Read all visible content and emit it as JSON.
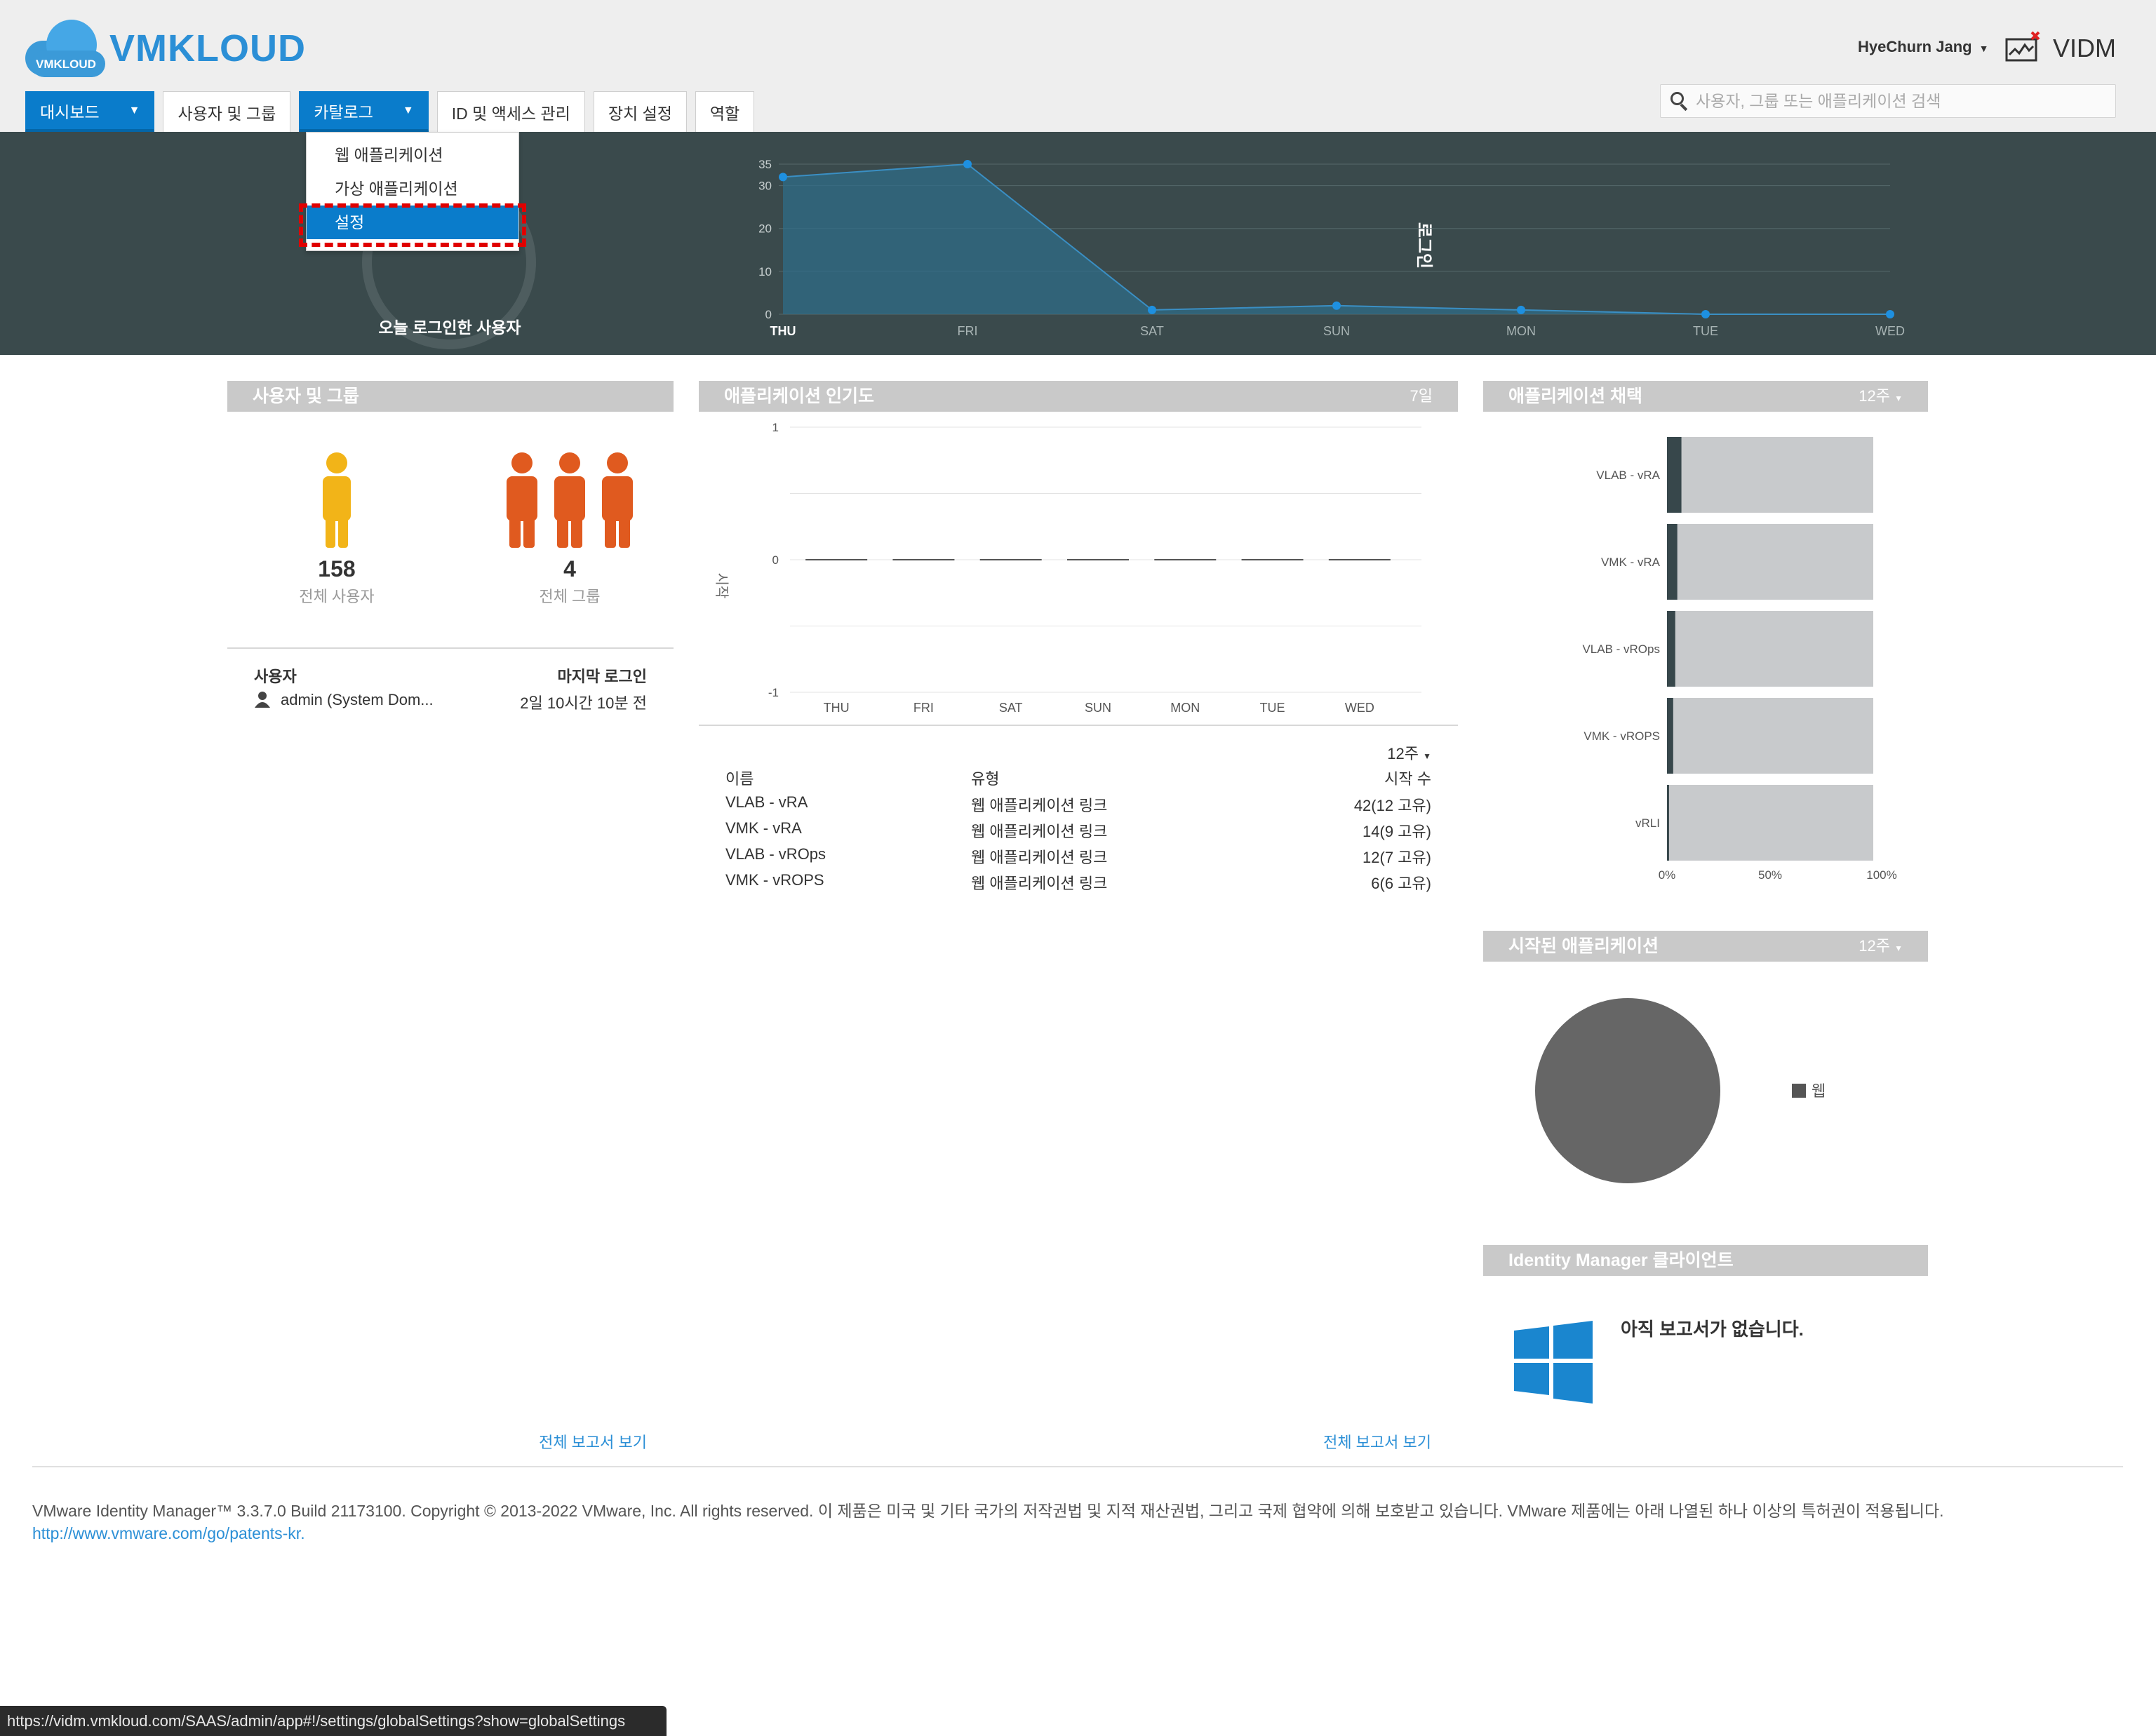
{
  "brand": {
    "logo_badge": "VMKLOUD",
    "name": "VMKLOUD"
  },
  "header": {
    "user_name": "HyeChurn Jang",
    "tenant": "VIDM"
  },
  "nav": {
    "tabs": [
      {
        "label": "대시보드",
        "active": true,
        "has_menu": true
      },
      {
        "label": "사용자 및 그룹"
      },
      {
        "label": "카탈로그",
        "active": true,
        "has_menu": true
      },
      {
        "label": "ID 및 액세스 관리"
      },
      {
        "label": "장치 설정"
      },
      {
        "label": "역할"
      }
    ],
    "catalog_menu": [
      "웹 애플리케이션",
      "가상 애플리케이션",
      "설정"
    ],
    "catalog_menu_highlighted": "설정"
  },
  "search": {
    "placeholder": "사용자, 그룹 또는 애플리케이션 검색"
  },
  "banner": {
    "gauge_label": "오늘 로그인한 사용자",
    "chart_data": {
      "type": "area",
      "ylabel": "로그인",
      "ylim": [
        0,
        35
      ],
      "yticks": [
        0,
        10,
        20,
        30,
        35
      ],
      "categories": [
        "THU",
        "FRI",
        "SAT",
        "SUN",
        "MON",
        "TUE",
        "WED"
      ],
      "values": [
        32,
        35,
        1,
        2,
        1,
        0,
        0
      ],
      "highlighted_category": "THU"
    }
  },
  "users_panel": {
    "title": "사용자 및 그룹",
    "total_users": "158",
    "total_users_label": "전체 사용자",
    "total_groups": "4",
    "total_groups_label": "전체 그룹",
    "col_user": "사용자",
    "col_last_login": "마지막 로그인",
    "rows": [
      {
        "user": "admin (System Dom...",
        "last_login": "2일 10시간 10분 전"
      }
    ],
    "view_all": "전체 보고서 보기",
    "colors": {
      "user": "#f2b418",
      "group": "#e05a1f"
    }
  },
  "popularity_panel": {
    "title": "애플리케이션 인기도",
    "range": "7일",
    "chart_data": {
      "type": "bar",
      "ylabel": "시작",
      "ylim": [
        -1,
        1
      ],
      "yticks": [
        1,
        0,
        -1
      ],
      "categories": [
        "THU",
        "FRI",
        "SAT",
        "SUN",
        "MON",
        "TUE",
        "WED"
      ],
      "values": [
        0,
        0,
        0,
        0,
        0,
        0,
        0
      ]
    },
    "period": "12주",
    "table": {
      "headers": [
        "이름",
        "유형",
        "시작 수"
      ],
      "rows": [
        [
          "VLAB - vRA",
          "웹 애플리케이션 링크",
          "42(12 고유)"
        ],
        [
          "VMK - vRA",
          "웹 애플리케이션 링크",
          "14(9 고유)"
        ],
        [
          "VLAB - vROps",
          "웹 애플리케이션 링크",
          "12(7 고유)"
        ],
        [
          "VMK - vROPS",
          "웹 애플리케이션 링크",
          "6(6 고유)"
        ]
      ]
    },
    "view_all": "전체 보고서 보기"
  },
  "adoption_panel": {
    "title": "애플리케이션 채택",
    "period": "12주",
    "chart_data": {
      "type": "bar",
      "orientation": "horizontal",
      "categories": [
        "VLAB - vRA",
        "VMK - vRA",
        "VLAB - vROps",
        "VMK - vROPS",
        "vRLI"
      ],
      "values": [
        7,
        5,
        4,
        3,
        1
      ],
      "xlim": [
        0,
        100
      ],
      "xticks": [
        "0%",
        "50%",
        "100%"
      ]
    }
  },
  "launched_panel": {
    "title": "시작된 애플리케이션",
    "period": "12주",
    "chart_data": {
      "type": "pie",
      "slices": [
        {
          "name": "웹",
          "value": 100,
          "color": "#666666"
        }
      ]
    }
  },
  "client_panel": {
    "title": "Identity Manager 클라이언트",
    "message": "아직 보고서가 없습니다."
  },
  "footer": {
    "text": "VMware Identity Manager™ 3.3.7.0 Build 21173100. Copyright © 2013-2022 VMware, Inc. All rights reserved. 이 제품은 미국 및 기타 국가의 저작권법 및 지적 재산권법, 그리고 국제 협약에 의해 보호받고 있습니다. VMware 제품에는 아래 나열된 하나 이상의 특허권이 적용됩니다.",
    "link": "http://www.vmware.com/go/patents-kr."
  },
  "status_url": "https://vidm.vmkloud.com/SAAS/admin/app#!/settings/globalSettings?show=globalSettings",
  "colors": {
    "accent": "#0a7ccb",
    "banner_bg": "#3a4a4c",
    "panel_head": "#c9c9c9",
    "highlight": "#e00000"
  }
}
